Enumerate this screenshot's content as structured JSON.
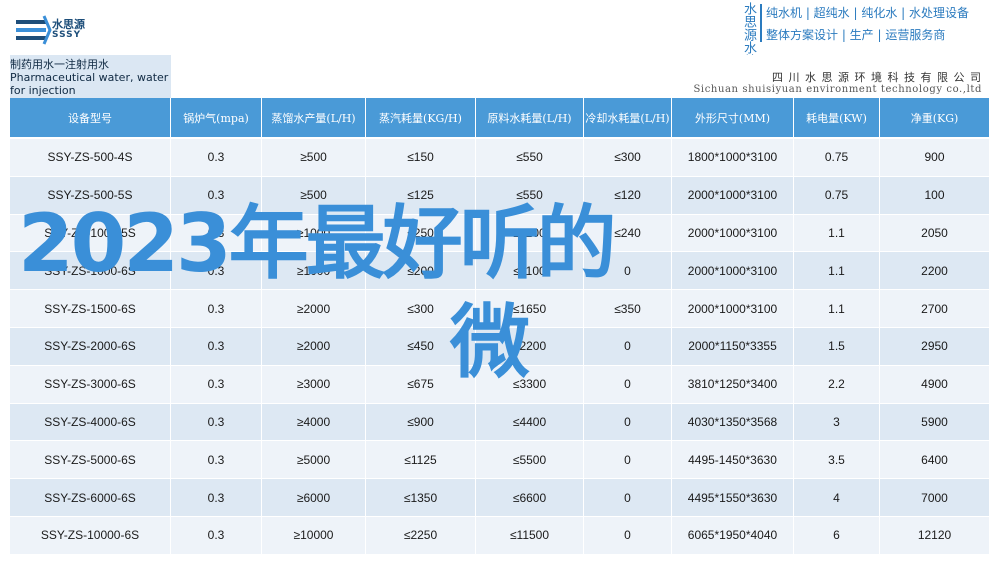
{
  "brand": {
    "logo_cn": "水思源",
    "logo_en": "SSSY",
    "vertical": "水思源水处理",
    "services_line1": "纯水机 | 超纯水 | 纯化水 | 水处理设备",
    "services_line2": "整体方案设计 | 生产 | 运营服务商"
  },
  "table_title": "制药用水一注射用水 Pharmaceutical water, water for injection",
  "company_cn": "四 川 水 思 源 环 境 科 技 有 限 公 司",
  "company_en": "Sichuan shuisiyuan environment technology co.,ltd",
  "columns": [
    "设备型号",
    "锅炉气(mpa)",
    "蒸馏水产量(L/H)",
    "蒸汽耗量(KG/H)",
    "原料水耗量(L/H)",
    "冷却水耗量(L/H)",
    "外形尺寸(MM)",
    "耗电量(KW)",
    "净重(KG)"
  ],
  "rows": [
    [
      "SSY-ZS-500-4S",
      "0.3",
      "≥500",
      "≤150",
      "≤550",
      "≤300",
      "1800*1000*3100",
      "0.75",
      "900"
    ],
    [
      "SSY-ZS-500-5S",
      "0.3",
      "≥500",
      "≤125",
      "≤550",
      "≤120",
      "2000*1000*3100",
      "0.75",
      "100"
    ],
    [
      "SSY-ZS-1000-5S",
      "0.3",
      "≥1000",
      "≤250",
      "≤1100",
      "≤240",
      "2000*1000*3100",
      "1.1",
      "2050"
    ],
    [
      "SSY-ZS-1000-6S",
      "0.3",
      "≥1000",
      "≤200",
      "≤1100",
      "0",
      "2000*1000*3100",
      "1.1",
      "2200"
    ],
    [
      "SSY-ZS-1500-6S",
      "0.3",
      "≥2000",
      "≤300",
      "≤1650",
      "≤350",
      "2000*1000*3100",
      "1.1",
      "2700"
    ],
    [
      "SSY-ZS-2000-6S",
      "0.3",
      "≥2000",
      "≤450",
      "≤2200",
      "0",
      "2000*1150*3355",
      "1.5",
      "2950"
    ],
    [
      "SSY-ZS-3000-6S",
      "0.3",
      "≥3000",
      "≤675",
      "≤3300",
      "0",
      "3810*1250*3400",
      "2.2",
      "4900"
    ],
    [
      "SSY-ZS-4000-6S",
      "0.3",
      "≥4000",
      "≤900",
      "≤4400",
      "0",
      "4030*1350*3568",
      "3",
      "5900"
    ],
    [
      "SSY-ZS-5000-6S",
      "0.3",
      "≥5000",
      "≤1125",
      "≤5500",
      "0",
      "4495-1450*3630",
      "3.5",
      "6400"
    ],
    [
      "SSY-ZS-6000-6S",
      "0.3",
      "≥6000",
      "≤1350",
      "≤6600",
      "0",
      "4495*1550*3630",
      "4",
      "7000"
    ],
    [
      "SSY-ZS-10000-6S",
      "0.3",
      "≥10000",
      "≤2250",
      "≤11500",
      "0",
      "6065*1950*4040",
      "6",
      "12120"
    ]
  ],
  "overlay_line1": "2023年最好听的",
  "overlay_line2": "微"
}
